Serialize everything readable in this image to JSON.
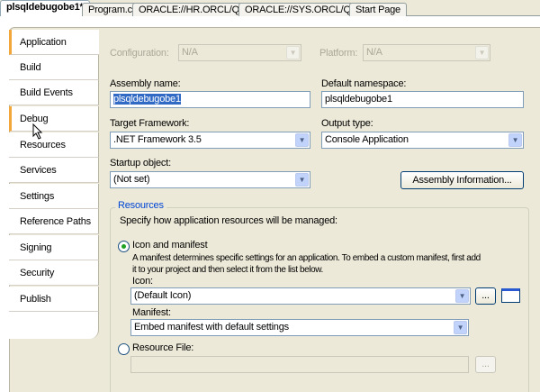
{
  "tabs": [
    "plsqldebugobe1*",
    "Program.cs",
    "ORACLE://HR.ORCL/Query",
    "ORACLE://SYS.ORCL/Query",
    "Start Page"
  ],
  "sidebar": [
    "Application",
    "Build",
    "Build Events",
    "Debug",
    "Resources",
    "Services",
    "Settings",
    "Reference Paths",
    "Signing",
    "Security",
    "Publish"
  ],
  "config": {
    "configuration_label": "Configuration:",
    "configuration_value": "N/A",
    "platform_label": "Platform:",
    "platform_value": "N/A"
  },
  "form": {
    "assembly_label": "Assembly name:",
    "assembly_value": "plsqldebugobe1",
    "namespace_label": "Default namespace:",
    "namespace_value": "plsqldebugobe1",
    "framework_label": "Target Framework:",
    "framework_value": ".NET Framework 3.5",
    "output_label": "Output type:",
    "output_value": "Console Application",
    "startup_label": "Startup object:",
    "startup_value": "(Not set)",
    "assembly_info_button": "Assembly Information..."
  },
  "resources": {
    "legend": "Resources",
    "intro": "Specify how application resources will be managed:",
    "icon_manifest_label": "Icon and manifest",
    "description_line1": "A manifest determines specific settings for an application. To embed a custom manifest, first add",
    "description_line2": "it to your project and then select it from the list below.",
    "icon_label": "Icon:",
    "icon_value": "(Default Icon)",
    "browse": "...",
    "manifest_label": "Manifest:",
    "manifest_value": "Embed manifest with default settings",
    "resource_file_label": "Resource File:",
    "resource_file_value": ""
  }
}
